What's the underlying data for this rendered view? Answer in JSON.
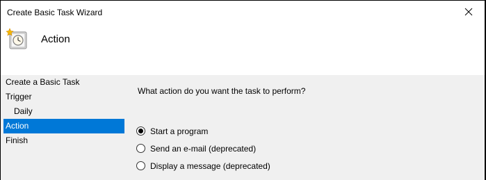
{
  "window": {
    "title": "Create Basic Task Wizard"
  },
  "header": {
    "title": "Action"
  },
  "steps": [
    {
      "label": "Create a Basic Task"
    },
    {
      "label": "Trigger"
    },
    {
      "label": "Daily"
    },
    {
      "label": "Action"
    },
    {
      "label": "Finish"
    }
  ],
  "main": {
    "prompt": "What action do you want the task to perform?",
    "options": [
      {
        "label": "Start a program",
        "selected": true
      },
      {
        "label": "Send an e-mail (deprecated)",
        "selected": false
      },
      {
        "label": "Display a message (deprecated)",
        "selected": false
      }
    ]
  },
  "colors": {
    "selection": "#0078d7",
    "panel_background": "#f0f0f0"
  }
}
